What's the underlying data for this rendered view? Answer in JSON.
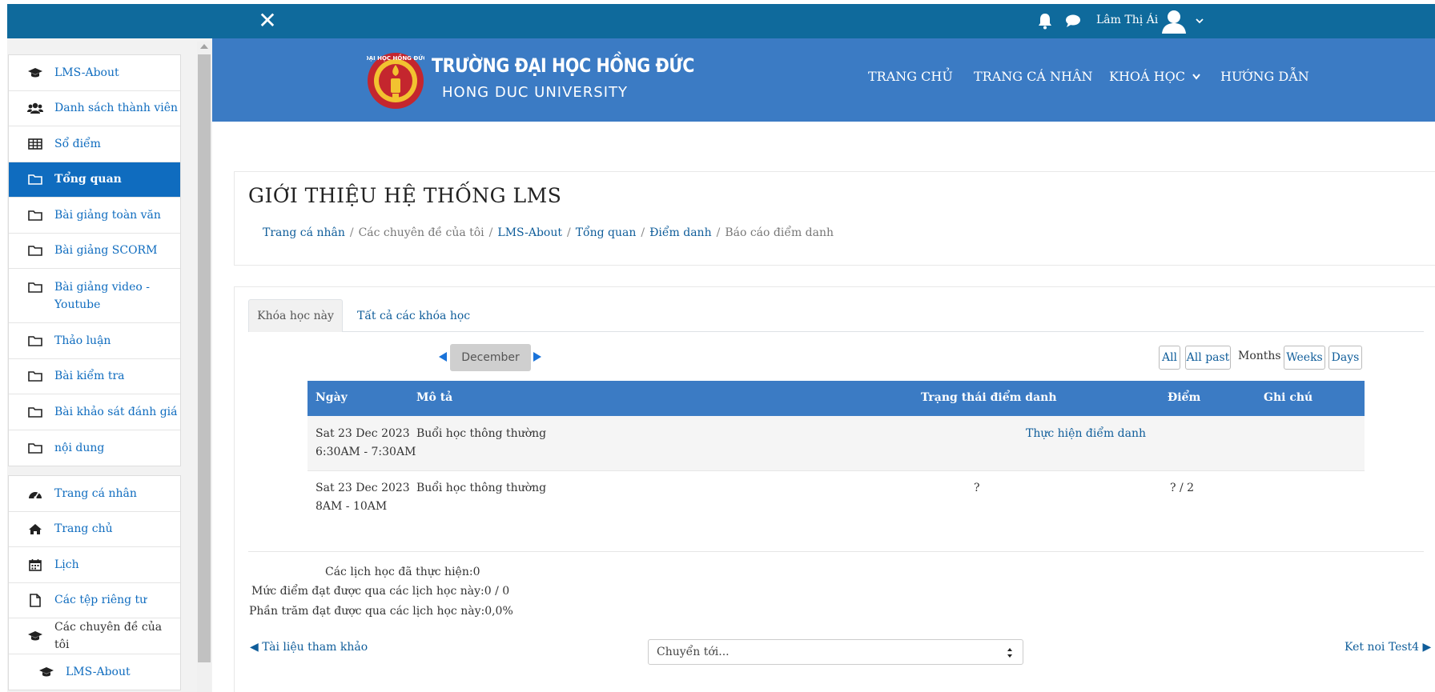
{
  "topbar": {
    "close_icon": "close-icon",
    "user_name": "Lâm Thị Ái",
    "icons": [
      "bell-icon",
      "chat-icon",
      "user-avatar-icon",
      "chevron-down-icon"
    ]
  },
  "sidebar": {
    "group1": [
      {
        "label": "LMS-About",
        "icon": "graduation-cap-icon"
      },
      {
        "label": "Danh sách thành viên",
        "icon": "users-icon"
      },
      {
        "label": "Sổ điểm",
        "icon": "table-icon"
      },
      {
        "label": "Tổng quan",
        "icon": "folder-icon",
        "active": true
      },
      {
        "label": "Bài giảng toàn văn",
        "icon": "folder-icon"
      },
      {
        "label": "Bài giảng SCORM",
        "icon": "folder-icon"
      },
      {
        "label": "Bài giảng video - Youtube",
        "icon": "folder-icon"
      },
      {
        "label": "Thảo luận",
        "icon": "folder-icon"
      },
      {
        "label": "Bài kiểm tra",
        "icon": "folder-icon"
      },
      {
        "label": "Bài khảo sát đánh giá",
        "icon": "folder-icon"
      },
      {
        "label": "nội dung",
        "icon": "folder-icon"
      }
    ],
    "group2": [
      {
        "label": "Trang cá nhân",
        "icon": "dashboard-icon"
      },
      {
        "label": "Trang chủ",
        "icon": "home-icon"
      },
      {
        "label": "Lịch",
        "icon": "calendar-icon"
      },
      {
        "label": "Các tệp riêng tư",
        "icon": "file-icon"
      },
      {
        "label": "Các chuyên đề của tôi",
        "icon": "graduation-cap-icon"
      },
      {
        "label": "LMS-About",
        "icon": "graduation-cap-icon"
      }
    ]
  },
  "header": {
    "logo_text": "ĐẠI HỌC HỒNG ĐỨC",
    "brand_line1": "TRƯỜNG ĐẠI HỌC HỒNG ĐỨC",
    "brand_line2": "HONG DUC UNIVERSITY",
    "nav": [
      "TRANG CHỦ",
      "TRANG CÁ NHÂN",
      "KHOÁ HỌC",
      "HƯỚNG DẪN"
    ]
  },
  "page": {
    "title": "GIỚI THIỆU HỆ THỐNG LMS",
    "breadcrumb": [
      "Trang cá nhân",
      "Các chuyên đề của tôi",
      "LMS-About",
      "Tổng quan",
      "Điểm danh",
      "Báo cáo điểm danh"
    ]
  },
  "tabs": {
    "active": "Khóa học này",
    "other": "Tất cả các khóa học"
  },
  "period": {
    "month": "December",
    "views": {
      "all": "All",
      "all_past": "All past",
      "months": "Months",
      "weeks": "Weeks",
      "days": "Days"
    }
  },
  "table": {
    "headers": [
      "Ngày",
      "Mô tả",
      "Trạng thái điểm danh",
      "Điểm",
      "Ghi chú"
    ],
    "rows": [
      {
        "date": "Sat 23 Dec 2023",
        "time": "6:30AM - 7:30AM",
        "desc": "Buổi học thông thường",
        "status": "Thực hiện điểm danh",
        "score": "",
        "note": ""
      },
      {
        "date": "Sat 23 Dec 2023",
        "time": "8AM - 10AM",
        "desc": "Buổi học thông thường",
        "status": "?",
        "score": "? / 2",
        "note": ""
      }
    ]
  },
  "summary": {
    "sessions_done": "Các lịch học đã thực hiện:",
    "sessions_done_value": "0",
    "score_label": "Mức điểm đạt được qua các lịch học này:",
    "score_value": "0 / 0",
    "percent_label": "Phần trăm đạt được qua các lịch học này:",
    "percent_value": "0,0%"
  },
  "footer_nav": {
    "prev": "◀ Tài liệu tham khảo",
    "jump_placeholder": "Chuyển tới...",
    "next": "Ket noi Test4 ▶"
  },
  "colors": {
    "topbar": "#0f6a9c",
    "banner": "#3b7bc4",
    "active_nav": "#0f6cbf",
    "link": "#0f5d9a"
  }
}
